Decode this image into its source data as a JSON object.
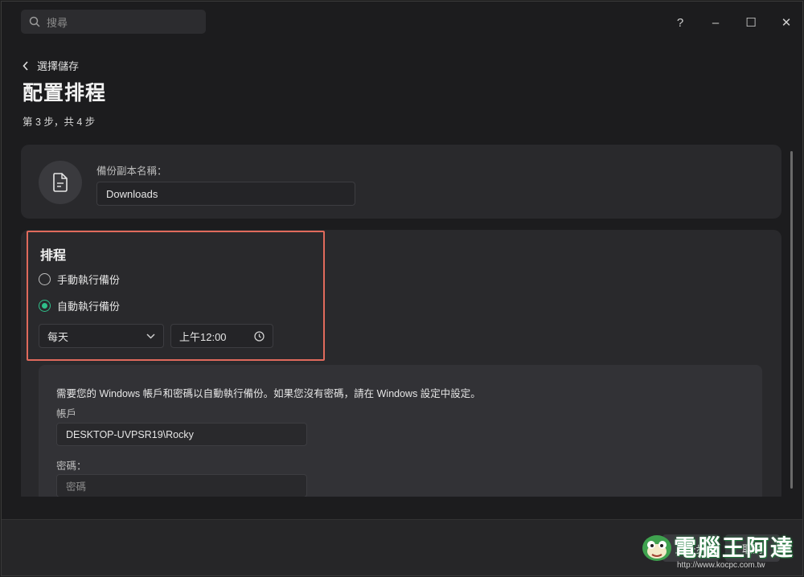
{
  "search": {
    "placeholder": "搜尋"
  },
  "window_controls": {
    "help": "?",
    "minimize": "–",
    "maximize": "☐",
    "close": "✕"
  },
  "nav": {
    "back_label": "選擇儲存"
  },
  "page": {
    "title": "配置排程",
    "step": "第 3 步，共 4 步"
  },
  "backup_name": {
    "label": "備份副本名稱：",
    "value": "Downloads"
  },
  "schedule": {
    "title": "排程",
    "options": [
      {
        "label": "手動執行備份",
        "checked": false
      },
      {
        "label": "自動執行備份",
        "checked": true
      }
    ],
    "frequency": "每天",
    "time": "上午12:00"
  },
  "credentials": {
    "notice": "需要您的 Windows 帳戶和密碼以自動執行備份。如果您沒有密碼，請在 Windows 設定中設定。",
    "account_label": "帳戶",
    "account_value": "DESKTOP-UVPSR19\\Rocky",
    "password_label": "密碼：",
    "password_placeholder": "密碼"
  },
  "footer": {
    "back": "上一步",
    "cancel": "取消"
  },
  "watermark": {
    "text": "電腦王阿達",
    "url": "http://www.kocpc.com.tw"
  },
  "colors": {
    "accent": "#2fbf8a",
    "highlight": "#e06a5c"
  }
}
